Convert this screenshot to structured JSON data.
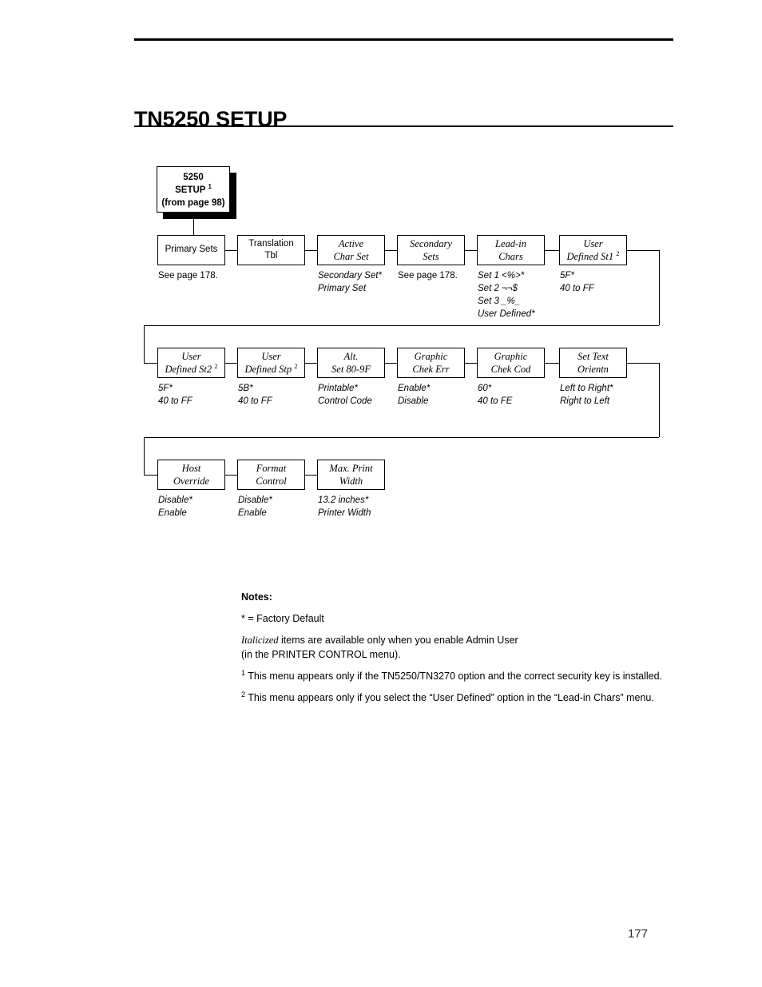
{
  "page": {
    "title": "TN5250 SETUP",
    "number": "177"
  },
  "root": {
    "line1": "5250",
    "line2": "SETUP",
    "line2_sup": "1",
    "line3": "(from page 98)"
  },
  "rows": [
    {
      "nodes": [
        {
          "l1": "Primary Sets",
          "l2": "",
          "sup": "",
          "italic": false,
          "opts": "See page 178.",
          "opts_italic": false
        },
        {
          "l1": "Translation",
          "l2": "Tbl",
          "sup": "",
          "italic": false,
          "opts": "",
          "opts_italic": false
        },
        {
          "l1": "Active",
          "l2": "Char Set",
          "sup": "",
          "italic": true,
          "opts": "Secondary Set*\nPrimary Set",
          "opts_italic": true
        },
        {
          "l1": "Secondary",
          "l2": "Sets",
          "sup": "",
          "italic": true,
          "opts": "See page 178.",
          "opts_italic": false
        },
        {
          "l1": "Lead-in",
          "l2": "Chars",
          "sup": "",
          "italic": true,
          "opts": "Set 1 <%>*\nSet 2 ¬¬$\nSet 3 _%_\nUser Defined*",
          "opts_italic": true
        },
        {
          "l1": "User",
          "l2": "Defined St1",
          "sup": "2",
          "italic": true,
          "opts": "5F*\n40 to FF",
          "opts_italic": true
        }
      ]
    },
    {
      "nodes": [
        {
          "l1": "User",
          "l2": "Defined St2",
          "sup": "2",
          "italic": true,
          "opts": "5F*\n40 to FF",
          "opts_italic": true
        },
        {
          "l1": "User",
          "l2": "Defined Stp",
          "sup": "2",
          "italic": true,
          "opts": "5B*\n40 to FF",
          "opts_italic": true
        },
        {
          "l1": "Alt.",
          "l2": "Set 80-9F",
          "sup": "",
          "italic": true,
          "opts": "Printable*\nControl Code",
          "opts_italic": true
        },
        {
          "l1": "Graphic",
          "l2": "Chek Err",
          "sup": "",
          "italic": true,
          "opts": "Enable*\nDisable",
          "opts_italic": true
        },
        {
          "l1": "Graphic",
          "l2": "Chek Cod",
          "sup": "",
          "italic": true,
          "opts": "60*\n40 to FE",
          "opts_italic": true
        },
        {
          "l1": "Set Text",
          "l2": "Orientn",
          "sup": "",
          "italic": true,
          "opts": "Left to Right*\nRight to Left",
          "opts_italic": true
        }
      ]
    },
    {
      "nodes": [
        {
          "l1": "Host",
          "l2": "Override",
          "sup": "",
          "italic": true,
          "opts": "Disable*\nEnable",
          "opts_italic": true
        },
        {
          "l1": "Format",
          "l2": "Control",
          "sup": "",
          "italic": true,
          "opts": "Disable*\nEnable",
          "opts_italic": true
        },
        {
          "l1": "Max. Print",
          "l2": "Width",
          "sup": "",
          "italic": true,
          "opts": "13.2 inches*\nPrinter Width",
          "opts_italic": true
        }
      ]
    }
  ],
  "notes": {
    "title": "Notes:",
    "factory_default": "* = Factory Default",
    "italic_word": "Italicized",
    "italic_rest": " items are available only when you enable Admin User",
    "italic_line2": "(in the PRINTER CONTROL menu).",
    "note1_sup": "1",
    "note1": " This menu appears only if the TN5250/TN3270 option and the correct security key is installed.",
    "note2_sup": "2",
    "note2": " This menu appears only if you select the “User Defined” option in the “Lead-in Chars” menu."
  },
  "colors": {
    "ink": "#000000",
    "paper": "#ffffff"
  }
}
